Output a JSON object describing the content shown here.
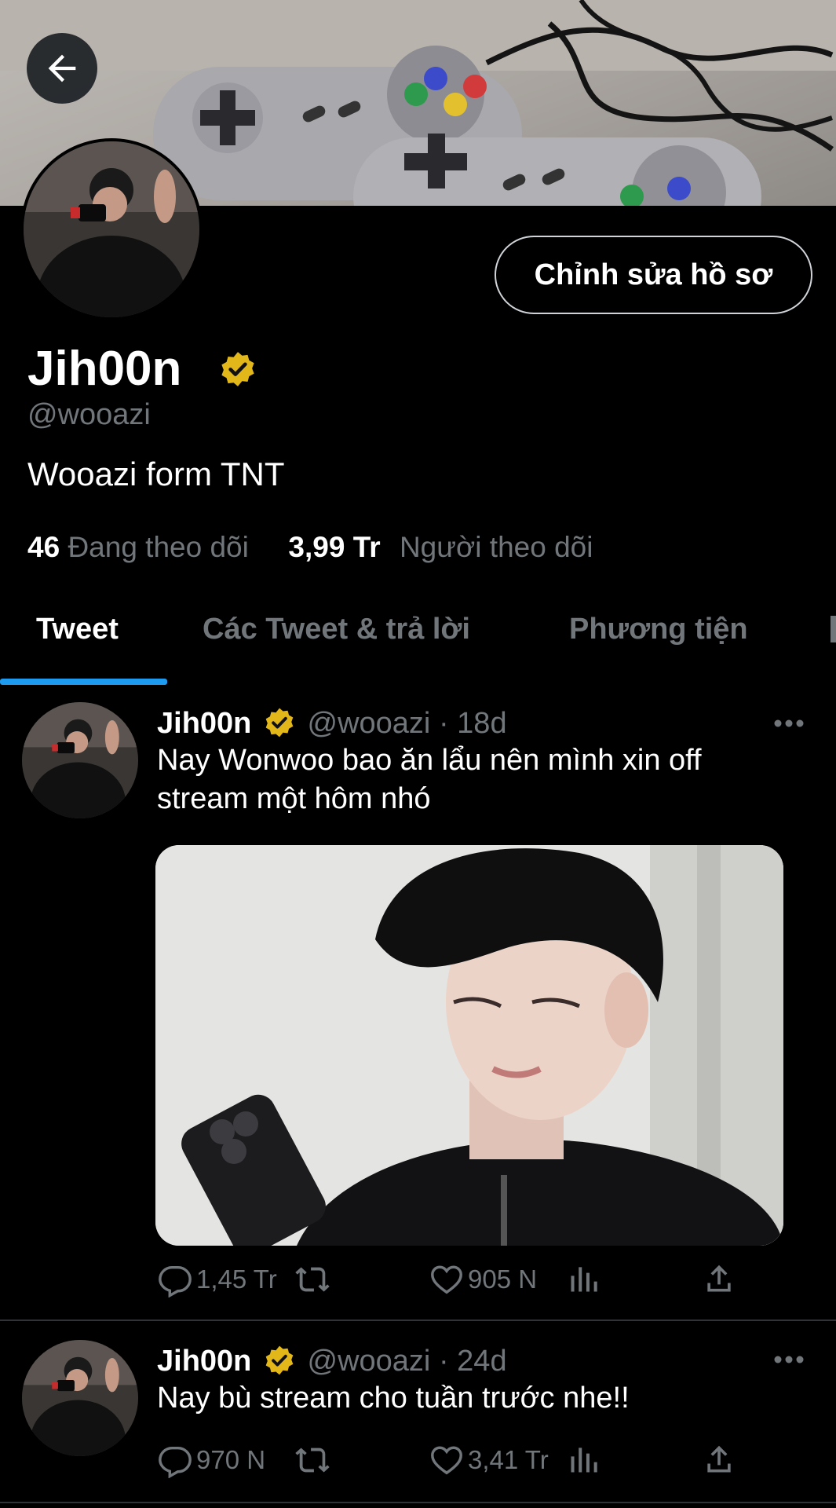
{
  "header": {
    "back_icon": "arrow-left-icon",
    "edit_profile_label": "Chỉnh sửa hồ sơ"
  },
  "profile": {
    "name": "Jih00n",
    "handle": "@wooazi",
    "bio": "Wooazi form TNT",
    "following_count": "46",
    "following_label": "Đang theo dõi",
    "followers_count": "3,99 Tr",
    "followers_label": "Người theo dõi",
    "verified_color": "#e2b719"
  },
  "tabs": [
    {
      "label": "Tweet",
      "active": true
    },
    {
      "label": "Các Tweet & trả lời",
      "active": false
    },
    {
      "label": "Phương tiện",
      "active": false
    }
  ],
  "accent_color": "#1d9bf0",
  "tweets": [
    {
      "name": "Jih00n",
      "handle": "@wooazi",
      "sep": "·",
      "time": "18d",
      "text": "Nay Wonwoo bao ăn lẩu nên mình xin off stream một hôm nhó",
      "replies": "1,45 Tr",
      "retweets": "",
      "likes": "905 N"
    },
    {
      "name": "Jih00n",
      "handle": "@wooazi",
      "sep": "·",
      "time": "24d",
      "text": "Nay bù stream cho tuần trước nhe!!",
      "replies": "970 N",
      "retweets": "",
      "likes": "3,41 Tr"
    }
  ]
}
